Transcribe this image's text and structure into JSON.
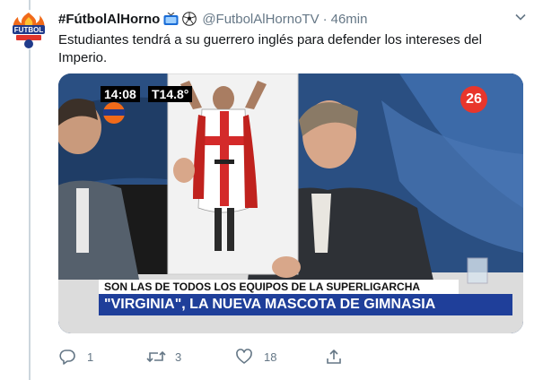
{
  "tweet": {
    "display_name": "#FútbolAlHorno",
    "emoji": [
      "tv-emoji",
      "soccer-ball-emoji"
    ],
    "handle": "@FutbolAlHornoTV",
    "separator": "·",
    "time": "46min",
    "text": "Estudiantes tendrá a su guerrero inglés para defender los intereses del Imperio."
  },
  "media": {
    "osd_time": "14:08",
    "osd_temp": "T14.8°",
    "channel_number": "26",
    "lower_third_top": "SON LAS DE TODOS LOS EQUIPOS DE LA SUPERLIGARCHA",
    "lower_third_main": "\"VIRGINIA\", LA NUEVA MASCOTA DE GIMNASIA",
    "colors": {
      "ticker_blue": "#1f3f9a",
      "background_blue": "#274a78"
    }
  },
  "actions": {
    "reply_count": "1",
    "retweet_count": "3",
    "like_count": "18"
  }
}
